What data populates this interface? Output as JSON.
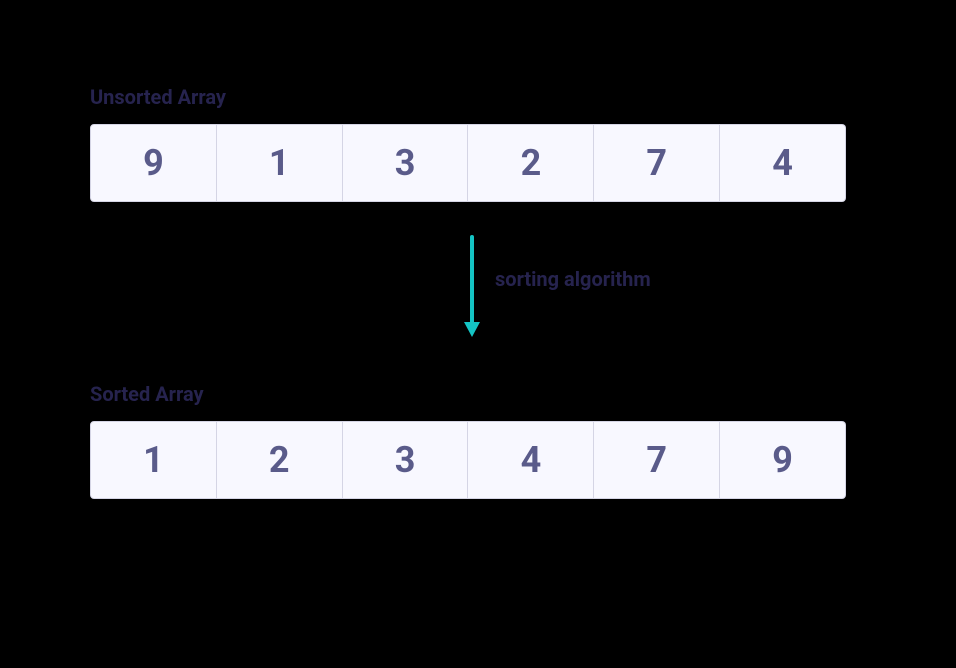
{
  "unsorted": {
    "label": "Unsorted Array",
    "values": [
      "9",
      "1",
      "3",
      "2",
      "7",
      "4"
    ]
  },
  "arrow": {
    "label": "sorting algorithm",
    "color": "#14c4c4"
  },
  "sorted": {
    "label": "Sorted Array",
    "values": [
      "1",
      "2",
      "3",
      "4",
      "7",
      "9"
    ]
  }
}
